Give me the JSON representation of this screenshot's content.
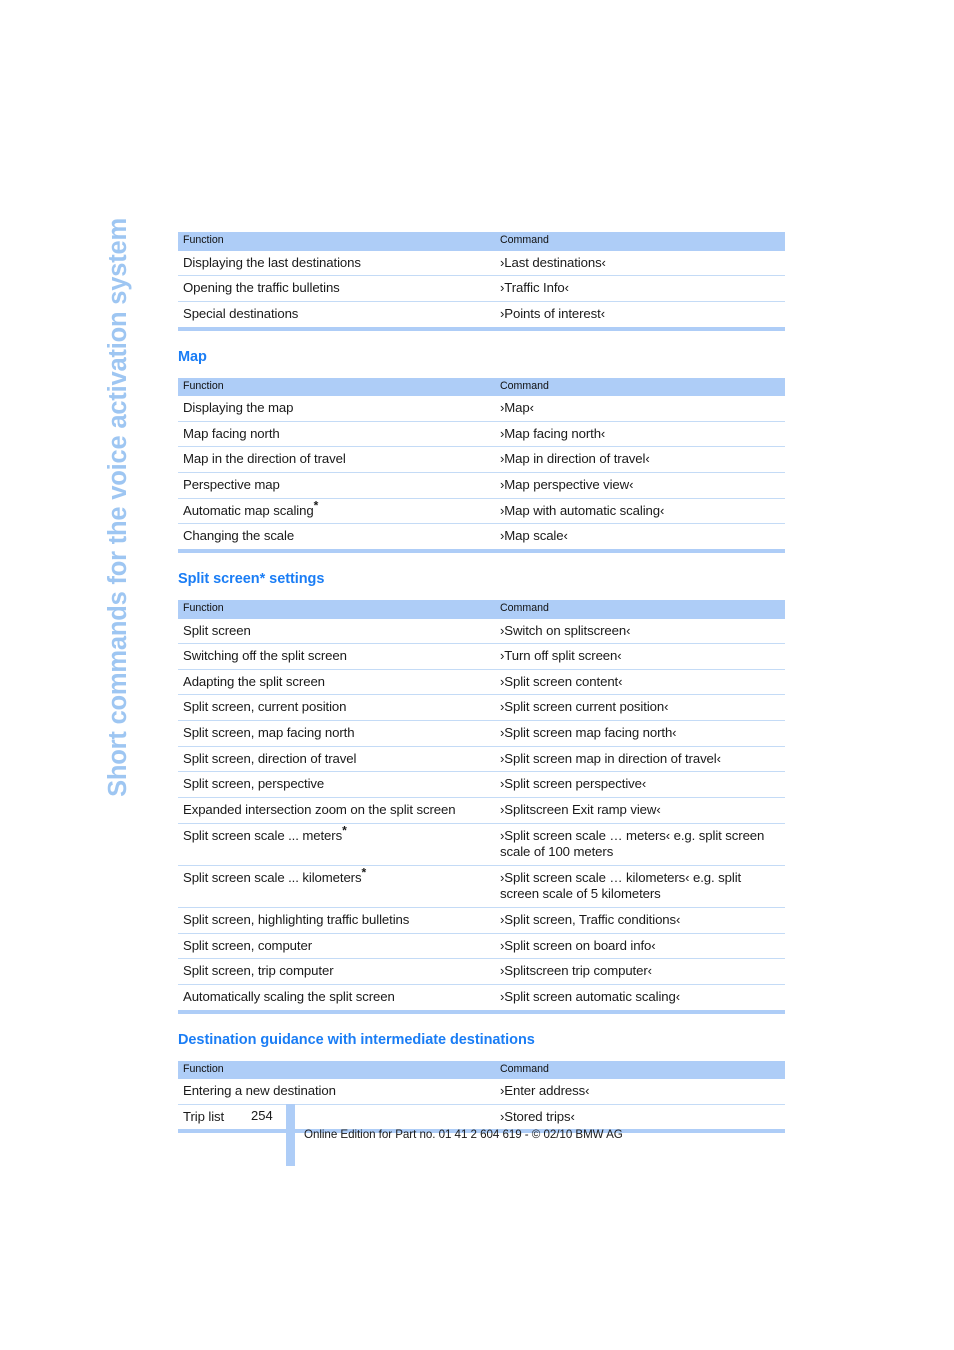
{
  "chapter_tab": {
    "title": "Short commands for the voice activation system",
    "color": "#9ec6f2"
  },
  "theme": {
    "heading_blue": "#1a7df5",
    "table_header_bg": "#aecdf7",
    "row_rule": "#c4dbf6"
  },
  "columns": {
    "function": "Function",
    "command": "Command"
  },
  "tables": [
    {
      "id": "destinations-table",
      "heading": null,
      "rows": [
        {
          "function": "Displaying the last destinations",
          "command": "›Last destinations‹"
        },
        {
          "function": "Opening the traffic bulletins",
          "command": "›Traffic Info‹"
        },
        {
          "function": "Special destinations",
          "command": "›Points of interest‹"
        }
      ]
    },
    {
      "id": "map-table",
      "heading": "Map",
      "heading_asterisk": false,
      "rows": [
        {
          "function": "Displaying the map",
          "command": "›Map‹"
        },
        {
          "function": "Map facing north",
          "command": "›Map facing north‹"
        },
        {
          "function": "Map in the direction of travel",
          "command": "›Map in direction of travel‹"
        },
        {
          "function": "Perspective map",
          "command": "›Map perspective view‹"
        },
        {
          "function": "Automatic map scaling",
          "function_asterisk": true,
          "command": "›Map with automatic scaling‹"
        },
        {
          "function": "Changing the scale",
          "command": "›Map scale‹"
        }
      ]
    },
    {
      "id": "split-screen-table",
      "heading_pre": "Split screen",
      "heading_asterisk": true,
      "heading_post": " settings",
      "heading": "Split screen* settings",
      "rows": [
        {
          "function": "Split screen",
          "command": "›Switch on splitscreen‹"
        },
        {
          "function": "Switching off the split screen",
          "command": "›Turn off split screen‹"
        },
        {
          "function": "Adapting the split screen",
          "command": "›Split screen content‹"
        },
        {
          "function": "Split screen, current position",
          "command": "›Split screen current position‹"
        },
        {
          "function": "Split screen, map facing north",
          "command": "›Split screen map facing north‹"
        },
        {
          "function": "Split screen, direction of travel",
          "command": "›Split screen map in direction of travel‹"
        },
        {
          "function": "Split screen, perspective",
          "command": "›Split screen perspective‹"
        },
        {
          "function": "Expanded intersection zoom on the split screen",
          "command": "›Splitscreen Exit ramp view‹"
        },
        {
          "function": "Split screen scale ... meters",
          "function_asterisk": true,
          "command": "›Split screen scale … meters‹ e.g. split screen scale of 100 meters"
        },
        {
          "function": "Split screen scale ... kilometers",
          "function_asterisk": true,
          "command": "›Split screen scale … kilometers‹ e.g. split screen scale of 5 kilometers"
        },
        {
          "function": "Split screen, highlighting traffic bulletins",
          "command": "›Split screen, Traffic conditions‹"
        },
        {
          "function": "Split screen, computer",
          "command": "›Split screen on board info‹"
        },
        {
          "function": "Split screen, trip computer",
          "command": "›Splitscreen trip computer‹"
        },
        {
          "function": "Automatically scaling the split screen",
          "command": "›Split screen automatic scaling‹"
        }
      ]
    },
    {
      "id": "intermediate-destinations-table",
      "heading": "Destination guidance with intermediate destinations",
      "heading_asterisk": false,
      "rows": [
        {
          "function": "Entering a new destination",
          "command": "›Enter address‹"
        },
        {
          "function": "Trip list",
          "command": "›Stored trips‹"
        }
      ]
    }
  ],
  "footer": {
    "page_number": "254",
    "text": "Online Edition for Part no. 01 41 2 604 619 - © 02/10 BMW AG"
  }
}
